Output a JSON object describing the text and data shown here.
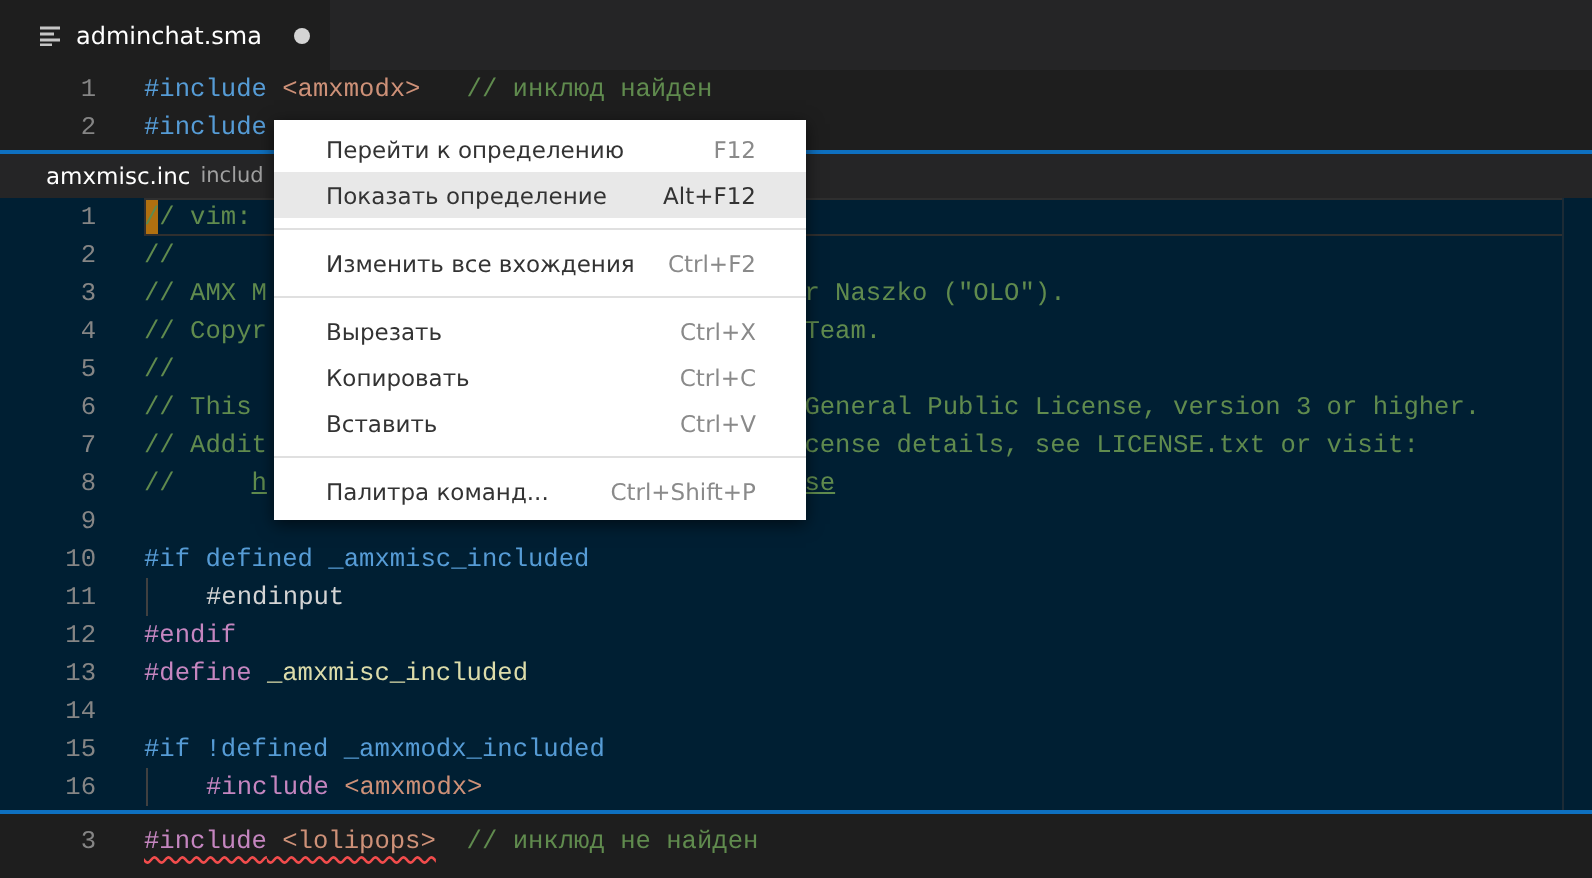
{
  "tab": {
    "label": "adminchat.sma",
    "dirty": true
  },
  "editor_top": [
    {
      "number": "1",
      "tokens": [
        {
          "text": "#include",
          "kind": "directive"
        },
        {
          "text": " <amxmodx>",
          "kind": "string"
        },
        {
          "text": "   // инклюд найден",
          "kind": "comment"
        }
      ]
    },
    {
      "number": "2",
      "tokens": [
        {
          "text": "#include",
          "kind": "directive"
        }
      ]
    }
  ],
  "peek": {
    "file": "amxmisc.inc",
    "path": "includ",
    "lines": [
      {
        "number": "1",
        "current": true,
        "tokens": [
          {
            "text": "// vim:",
            "kind": "comment"
          }
        ]
      },
      {
        "number": "2",
        "tokens": [
          {
            "text": "//",
            "kind": "comment"
          }
        ]
      },
      {
        "number": "3",
        "tokens": [
          {
            "text": "// AMX M",
            "kind": "comment"
          }
        ],
        "tail": [
          {
            "text": "r Naszko (\"OLO\").",
            "kind": "comment"
          }
        ]
      },
      {
        "number": "4",
        "tokens": [
          {
            "text": "// Copyr",
            "kind": "comment"
          }
        ],
        "tail": [
          {
            "text": "Team.",
            "kind": "comment"
          }
        ]
      },
      {
        "number": "5",
        "tokens": [
          {
            "text": "//",
            "kind": "comment"
          }
        ]
      },
      {
        "number": "6",
        "tokens": [
          {
            "text": "// This",
            "kind": "comment"
          }
        ],
        "tail": [
          {
            "text": "General Public License, version 3 or higher.",
            "kind": "comment"
          }
        ]
      },
      {
        "number": "7",
        "tokens": [
          {
            "text": "// Addit",
            "kind": "comment"
          }
        ],
        "tail": [
          {
            "text": "cense details, see LICENSE.txt or visit:",
            "kind": "comment"
          }
        ]
      },
      {
        "number": "8",
        "tokens": [
          {
            "text": "//     ",
            "kind": "comment"
          },
          {
            "text": "h",
            "kind": "link"
          }
        ],
        "tail": [
          {
            "text": "se",
            "kind": "link"
          }
        ]
      },
      {
        "number": "9"
      },
      {
        "number": "10",
        "tokens": [
          {
            "text": "#if",
            "kind": "directive"
          },
          {
            "text": " defined _amxmisc_included",
            "kind": "keyword"
          }
        ]
      },
      {
        "number": "11",
        "indent": true,
        "tokens": [
          {
            "text": "#endinput",
            "kind": "plain"
          }
        ]
      },
      {
        "number": "12",
        "tokens": [
          {
            "text": "#endif",
            "kind": "control"
          }
        ]
      },
      {
        "number": "13",
        "tokens": [
          {
            "text": "#define",
            "kind": "control"
          },
          {
            "text": " _amxmisc_included",
            "kind": "name"
          }
        ]
      },
      {
        "number": "14"
      },
      {
        "number": "15",
        "tokens": [
          {
            "text": "#if",
            "kind": "directive"
          },
          {
            "text": " !defined _amxmodx_included",
            "kind": "keyword"
          }
        ]
      },
      {
        "number": "16",
        "indent": true,
        "tokens": [
          {
            "text": "#include",
            "kind": "control"
          },
          {
            "text": " <amxmodx>",
            "kind": "string"
          }
        ]
      }
    ]
  },
  "editor_bottom": [
    {
      "number": "3",
      "squiggle": true,
      "tokens": [
        {
          "text": "#include",
          "kind": "control"
        },
        {
          "text": " <lolipops>",
          "kind": "string"
        }
      ],
      "after": [
        {
          "text": "  // инклюд не найден",
          "kind": "comment"
        }
      ]
    }
  ],
  "context_menu": {
    "groups": [
      [
        {
          "label": "Перейти к определению",
          "shortcut": "F12",
          "selected": false
        },
        {
          "label": "Показать определение",
          "shortcut": "Alt+F12",
          "selected": true
        }
      ],
      [
        {
          "label": "Изменить все вхождения",
          "shortcut": "Ctrl+F2",
          "selected": false
        }
      ],
      [
        {
          "label": "Вырезать",
          "shortcut": "Ctrl+X",
          "selected": false
        },
        {
          "label": "Копировать",
          "shortcut": "Ctrl+C",
          "selected": false
        },
        {
          "label": "Вставить",
          "shortcut": "Ctrl+V",
          "selected": false
        }
      ],
      [
        {
          "label": "Палитра команд...",
          "shortcut": "Ctrl+Shift+P",
          "selected": false
        }
      ]
    ]
  }
}
